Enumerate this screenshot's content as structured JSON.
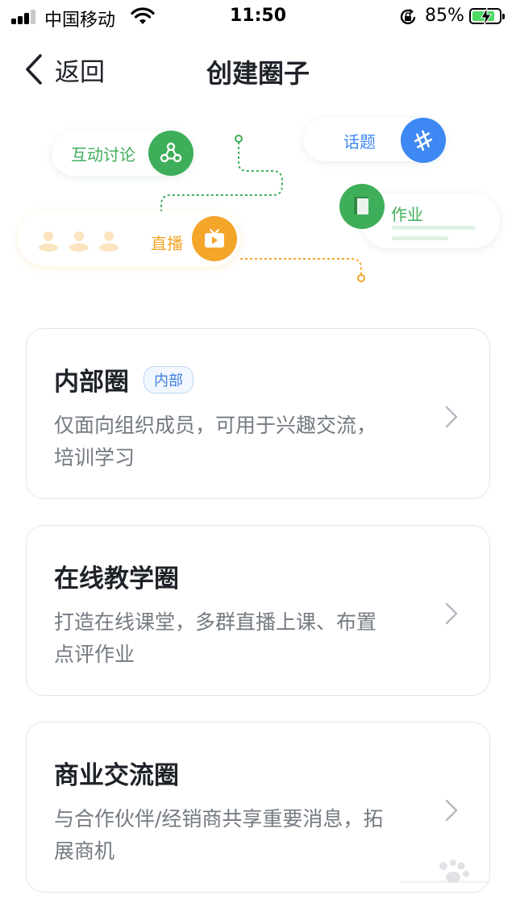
{
  "status_bar": {
    "carrier": "中国移动",
    "time": "11:50",
    "battery_percent": "85%",
    "battery_level": 0.85
  },
  "nav": {
    "back_label": "返回",
    "title": "创建圈子"
  },
  "illustration": {
    "interactive_label": "互动讨论",
    "topic_label": "话题",
    "homework_label": "作业",
    "live_label": "直播",
    "colors": {
      "green": "#3fae5a",
      "blue": "#3e88f4",
      "orange": "#f4a62a"
    }
  },
  "cards": [
    {
      "title": "内部圈",
      "badge": "内部",
      "desc": "仅面向组织成员，可用于兴趣交流，培训学习"
    },
    {
      "title": "在线教学圈",
      "desc": "打造在线课堂，多群直播上课、布置点评作业"
    },
    {
      "title": "商业交流圈",
      "desc": "与合作伙伴/经销商共享重要消息，拓展商机"
    }
  ]
}
